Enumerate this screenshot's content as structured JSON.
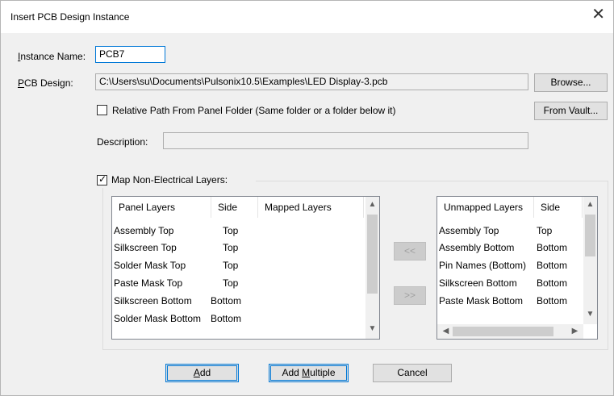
{
  "window": {
    "title": "Insert PCB Design Instance"
  },
  "instance_name": {
    "label_prefix": "",
    "label_ul": "I",
    "label_rest": "nstance Name:",
    "value": "PCB7"
  },
  "pcb_design": {
    "label_ul": "P",
    "label_rest": "CB Design:",
    "value": "C:\\Users\\su\\Documents\\Pulsonix10.5\\Examples\\LED Display-3.pcb"
  },
  "buttons": {
    "browse": "Browse...",
    "from_vault": "From Vault...",
    "move_left": "<<",
    "move_right": ">>",
    "add_ul": "A",
    "add_rest": "dd",
    "add_multiple_prefix": "Add ",
    "add_multiple_ul": "M",
    "add_multiple_rest": "ultiple",
    "cancel": "Cancel"
  },
  "relative_path": {
    "label": "Relative Path From Panel Folder (Same folder or a folder below it)",
    "checked": false
  },
  "description": {
    "label": "Description:",
    "value": ""
  },
  "map_layers": {
    "label": "Map Non-Electrical Layers:",
    "checked": true
  },
  "panel_layers": {
    "columns": [
      "Panel Layers",
      "Side",
      "Mapped Layers"
    ],
    "rows": [
      {
        "layer": "Assembly Top",
        "side": "Top",
        "mapped": ""
      },
      {
        "layer": "Silkscreen Top",
        "side": "Top",
        "mapped": ""
      },
      {
        "layer": "Solder Mask Top",
        "side": "Top",
        "mapped": ""
      },
      {
        "layer": "Paste Mask Top",
        "side": "Top",
        "mapped": ""
      },
      {
        "layer": "Silkscreen Bottom",
        "side": "Bottom",
        "mapped": ""
      },
      {
        "layer": "Solder Mask Bottom",
        "side": "Bottom",
        "mapped": ""
      }
    ]
  },
  "unmapped_layers": {
    "columns": [
      "Unmapped Layers",
      "Side"
    ],
    "rows": [
      {
        "layer": "Assembly Top",
        "side": "Top"
      },
      {
        "layer": "Assembly Bottom",
        "side": "Bottom"
      },
      {
        "layer": "Pin Names (Bottom)",
        "side": "Bottom"
      },
      {
        "layer": "Silkscreen Bottom",
        "side": "Bottom"
      },
      {
        "layer": "Paste Mask Bottom",
        "side": "Bottom"
      }
    ]
  },
  "icons": {
    "close": "close-icon",
    "check": "check-icon",
    "up": "chevron-up-icon",
    "down": "chevron-down-icon",
    "left": "chevron-left-icon",
    "right": "chevron-right-icon"
  }
}
